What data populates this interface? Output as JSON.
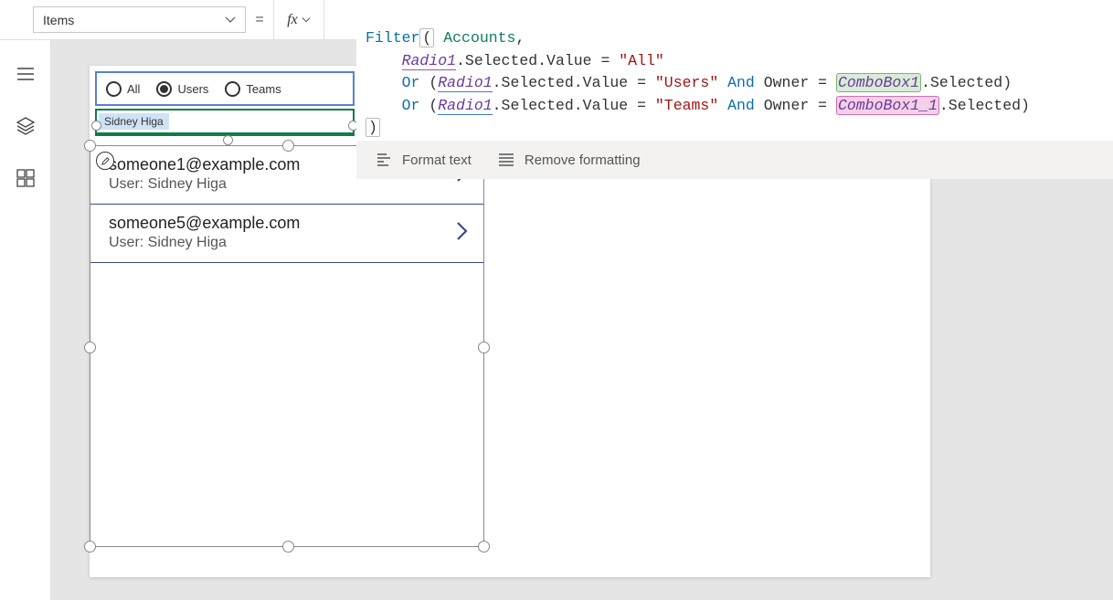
{
  "property_selector": {
    "value": "Items"
  },
  "fx_label": "fx",
  "eq_sign": "=",
  "formula": {
    "l1": {
      "fn": "Filter",
      "ds": "Accounts"
    },
    "l2": {
      "ctl": "Radio1",
      "prop": ".Selected.Value",
      "eq": " = ",
      "str": "\"All\""
    },
    "l3": {
      "or": "Or ",
      "ctl": "Radio1",
      "prop": ".Selected.Value",
      "eq": " = ",
      "str": "\"Users\"",
      "and": " And ",
      "owner": "Owner",
      "eq2": " = ",
      "combo": "ComboBox1",
      "sel": ".Selected)"
    },
    "l4": {
      "or": "Or ",
      "ctl": "Radio1",
      "prop": ".Selected.Value",
      "eq": " = ",
      "str": "\"Teams\"",
      "and": " And ",
      "owner": "Owner",
      "eq2": " = ",
      "combo": "ComboBox1_1",
      "sel": ".Selected)"
    },
    "close_paren": ")"
  },
  "formula_tools": {
    "format": "Format text",
    "remove": "Remove formatting"
  },
  "radio": {
    "opt1": "All",
    "opt2": "Users",
    "opt3": "Teams",
    "selected": "Users"
  },
  "combo": {
    "chip": "Sidney Higa"
  },
  "gallery": {
    "rows": [
      {
        "email": "someone1@example.com",
        "sub": "User: Sidney Higa"
      },
      {
        "email": "someone5@example.com",
        "sub": "User: Sidney Higa"
      }
    ]
  }
}
